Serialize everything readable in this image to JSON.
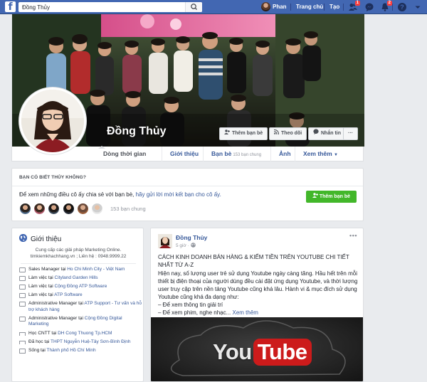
{
  "topbar": {
    "search_value": "Đồng Thủy",
    "user_name": "Phan",
    "home_label": "Trang chủ",
    "create_label": "Tạo",
    "friend_requests_count": "1",
    "notifications_count": "2",
    "brand_color": "#4267b2",
    "icons": [
      "facebook-logo-icon",
      "search-icon",
      "friend-requests-icon",
      "messenger-icon",
      "notifications-icon",
      "help-icon",
      "dropdown-arrow-icon"
    ]
  },
  "profile": {
    "name": "Đồng Thủy",
    "buttons": {
      "add_friend": "Thêm bạn bè",
      "follow": "Theo dõi",
      "message": "Nhắn tin",
      "more": "···"
    },
    "tabs": {
      "timeline": "Dòng thời gian",
      "about": "Giới thiệu",
      "friends": "Bạn bè",
      "friends_mutual": "153 bạn chung",
      "photos": "Ảnh",
      "more": "Xem thêm"
    }
  },
  "know": {
    "title": "BẠN CÓ BIẾT THỦY KHÔNG?",
    "text": "Để xem những điều cô ấy chia sẻ với bạn bè, ",
    "link": "hãy gửi lời mời kết bạn cho cô ấy.",
    "button": "Thêm bạn bè",
    "mutual_count": "153 bạn chung",
    "accent_color": "#42b72a"
  },
  "intro": {
    "title": "Giới thiệu",
    "bio_line1": "Cung cấp các giải pháp Marketing Online.",
    "bio_line2": "timkiemkhachhang.vn ; Liên hệ : 0948.9999.22",
    "items": [
      {
        "icon": "briefcase-icon",
        "prefix": "Sales Manager tại ",
        "link": "Ho Chi Minh City - Việt Nam"
      },
      {
        "icon": "briefcase-icon",
        "prefix": "Làm việc tại ",
        "link": "Cityland Garden Hills"
      },
      {
        "icon": "briefcase-icon",
        "prefix": "Làm việc tại ",
        "link": "Cộng Đồng ATP Software"
      },
      {
        "icon": "briefcase-icon",
        "prefix": "Làm việc tại ",
        "link": "ATP Software"
      },
      {
        "icon": "briefcase-icon",
        "prefix": "Administrative Manager tại ",
        "link": "ATP Support - Tư vấn và hỗ trợ khách hàng"
      },
      {
        "icon": "briefcase-icon",
        "prefix": "Administrative Manager tại ",
        "link": "Cộng Đồng Digital Marketing"
      },
      {
        "icon": "graduation-cap-icon",
        "prefix": "Học CNTT tại ",
        "link": "DH Cong Thuong Tp.HCM"
      },
      {
        "icon": "graduation-cap-icon",
        "prefix": "Đã học tại ",
        "link": "THPT Nguyễn Huệ-Tây Sơn-Bình Định"
      },
      {
        "icon": "home-icon",
        "prefix": "Sống tại ",
        "link": "Thành phố Hồ Chí Minh"
      }
    ]
  },
  "post": {
    "author": "Đồng Thủy",
    "time": "5 giờ · ",
    "privacy_icon": "globe-icon",
    "title": "CÁCH KINH DOANH BÁN HÀNG & KIẾM TIỀN TRÊN YOUTUBE CHI TIẾT NHẤT TỪ A-Z",
    "body_text": "Hiện nay, số lượng user trẻ sử dụng Youtube ngày càng tăng. Hầu hết trên mỗi thiết bị điện thoại của người dùng đều cài đặt ứng dụng Youtube, và thời lượng user truy cập trên nền tảng Youtube cũng khá lâu. Hành vi & mục đích sử dụng Youtube cũng khá đa dạng như:",
    "bullet1": "– Để xem thông tin giải trí",
    "bullet2": "– Để xem phim, nghe nhạc... ",
    "see_more": "Xem thêm",
    "image_text_you": "You",
    "image_text_tube": "Tube",
    "more": "•••"
  }
}
